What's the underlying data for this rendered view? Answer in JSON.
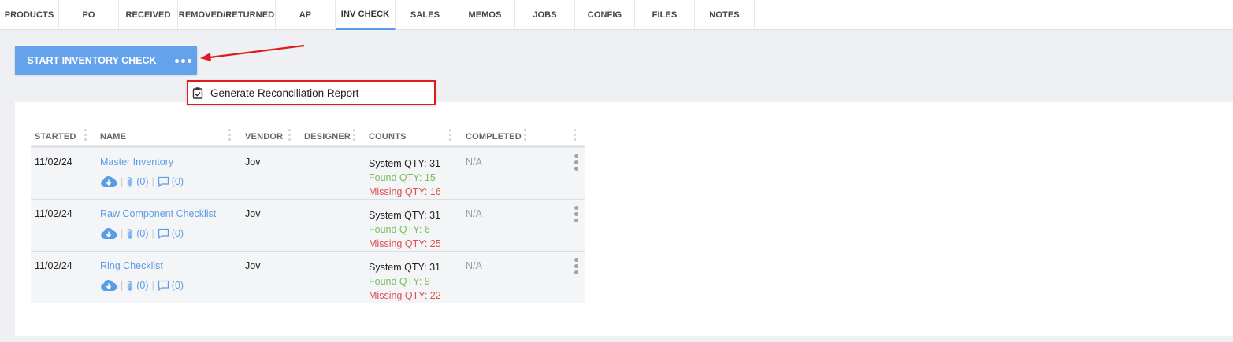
{
  "tabs": [
    {
      "label": "PRODUCTS",
      "active": false
    },
    {
      "label": "PO",
      "active": false
    },
    {
      "label": "RECEIVED",
      "active": false
    },
    {
      "label": "REMOVED/RETURNED",
      "active": false
    },
    {
      "label": "AP",
      "active": false
    },
    {
      "label": "INV CHECK",
      "active": true
    },
    {
      "label": "SALES",
      "active": false
    },
    {
      "label": "MEMOS",
      "active": false
    },
    {
      "label": "JOBS",
      "active": false
    },
    {
      "label": "CONFIG",
      "active": false
    },
    {
      "label": "FILES",
      "active": false
    },
    {
      "label": "NOTES",
      "active": false
    }
  ],
  "toolbar": {
    "start_label": "START INVENTORY CHECK",
    "more_icon": "ellipsis-icon"
  },
  "dropdown": {
    "items": [
      {
        "label": "Generate Reconciliation Report",
        "icon": "clipboard-check-icon"
      }
    ]
  },
  "table": {
    "columns": [
      "STARTED",
      "NAME",
      "VENDOR",
      "DESIGNER",
      "COUNTS",
      "COMPLETED"
    ],
    "rows": [
      {
        "started": "11/02/24",
        "name": "Master Inventory",
        "vendor": "Jov",
        "designer": "",
        "attachments": "(0)",
        "comments": "(0)",
        "system_qty": "System QTY: 31",
        "found_qty": "Found QTY: 15",
        "missing_qty": "Missing QTY: 16",
        "completed": "N/A"
      },
      {
        "started": "11/02/24",
        "name": "Raw Component Checklist",
        "vendor": "Jov",
        "designer": "",
        "attachments": "(0)",
        "comments": "(0)",
        "system_qty": "System QTY: 31",
        "found_qty": "Found QTY: 6",
        "missing_qty": "Missing QTY: 25",
        "completed": "N/A"
      },
      {
        "started": "11/02/24",
        "name": "Ring Checklist",
        "vendor": "Jov",
        "designer": "",
        "attachments": "(0)",
        "comments": "(0)",
        "system_qty": "System QTY: 31",
        "found_qty": "Found QTY: 9",
        "missing_qty": "Missing QTY: 22",
        "completed": "N/A"
      }
    ]
  },
  "colors": {
    "accent": "#64a3ec",
    "link": "#5b9be6",
    "found": "#7dbb5b",
    "missing": "#d9534f",
    "highlight": "#e01b1b"
  }
}
